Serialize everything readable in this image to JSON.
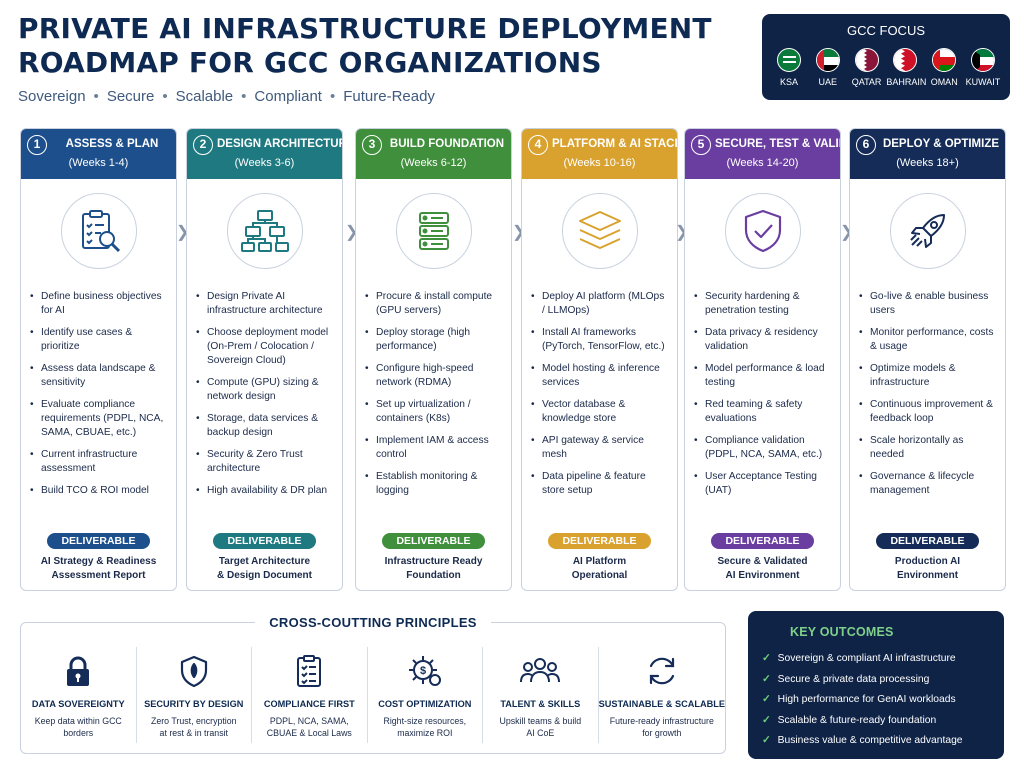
{
  "header": {
    "title": "PRIVATE AI INFRASTRUCTURE DEPLOYMENT ROADMAP FOR GCC ORGANIZATIONS",
    "tagline": [
      "Sovereign",
      "Secure",
      "Scalable",
      "Compliant",
      "Future-Ready"
    ],
    "tagline_separator": "•"
  },
  "gcc": {
    "title": "GCC FOCUS",
    "countries": [
      {
        "label": "KSA",
        "flag_icon": "saudi-flag-icon"
      },
      {
        "label": "UAE",
        "flag_icon": "uae-flag-icon"
      },
      {
        "label": "QATAR",
        "flag_icon": "qatar-flag-icon"
      },
      {
        "label": "BAHRAIN",
        "flag_icon": "bahrain-flag-icon"
      },
      {
        "label": "OMAN",
        "flag_icon": "oman-flag-icon"
      },
      {
        "label": "KUWAIT",
        "flag_icon": "kuwait-flag-icon"
      }
    ]
  },
  "phases": [
    {
      "num": "1",
      "title": "ASSESS & PLAN",
      "weeks": "(Weeks 1-4)",
      "color": "#1d4f8c",
      "icon": "clipboard-search-icon",
      "items": [
        "Define business objectives for AI",
        "Identify use cases & prioritize",
        "Assess data landscape & sensitivity",
        "Evaluate compliance requirements (PDPL, NCA, SAMA, CBUAE, etc.)",
        "Current infrastructure assessment",
        "Build TCO & ROI model"
      ],
      "deliverable_label": "DELIVERABLE",
      "deliverable_lines": [
        "AI Strategy & Readiness",
        "Assessment Report"
      ]
    },
    {
      "num": "2",
      "title": "DESIGN ARCHITECTURE",
      "weeks": "(Weeks 3-6)",
      "color": "#1e7a80",
      "icon": "hierarchy-icon",
      "items": [
        "Design Private AI infrastructure architecture",
        "Choose deployment model (On-Prem / Colocation / Sovereign Cloud)",
        "Compute (GPU) sizing & network design",
        "Storage, data services & backup design",
        "Security & Zero Trust architecture",
        "High availability & DR plan"
      ],
      "deliverable_label": "DELIVERABLE",
      "deliverable_lines": [
        "Target Architecture",
        "& Design Document"
      ]
    },
    {
      "num": "3",
      "title": "BUILD FOUNDATION",
      "weeks": "(Weeks 6-12)",
      "color": "#3f8f3c",
      "icon": "server-rack-icon",
      "items": [
        "Procure & install compute (GPU servers)",
        "Deploy storage (high performance)",
        "Configure high-speed network (RDMA)",
        "Set up virtualization / containers (K8s)",
        "Implement IAM & access control",
        "Establish monitoring & logging"
      ],
      "deliverable_label": "DELIVERABLE",
      "deliverable_lines": [
        "Infrastructure Ready",
        "Foundation"
      ]
    },
    {
      "num": "4",
      "title": "PLATFORM & AI STACK",
      "weeks": "(Weeks 10-16)",
      "color": "#d9a22e",
      "icon": "layers-icon",
      "items": [
        "Deploy AI platform (MLOps / LLMOps)",
        "Install AI frameworks (PyTorch, TensorFlow, etc.)",
        "Model hosting & inference services",
        "Vector database & knowledge store",
        "API gateway & service mesh",
        "Data pipeline & feature store setup"
      ],
      "deliverable_label": "DELIVERABLE",
      "deliverable_lines": [
        "AI Platform",
        "Operational"
      ]
    },
    {
      "num": "5",
      "title": "SECURE, TEST & VALIDATE",
      "weeks": "(Weeks 14-20)",
      "color": "#6a3ea1",
      "icon": "shield-check-icon",
      "items": [
        "Security hardening & penetration testing",
        "Data privacy & residency validation",
        "Model performance & load testing",
        "Red teaming & safety evaluations",
        "Compliance validation (PDPL, NCA, SAMA, etc.)",
        "User Acceptance Testing (UAT)"
      ],
      "deliverable_label": "DELIVERABLE",
      "deliverable_lines": [
        "Secure & Validated",
        "AI Environment"
      ]
    },
    {
      "num": "6",
      "title": "DEPLOY & OPTIMIZE",
      "weeks": "(Weeks 18+)",
      "color": "#142c57",
      "icon": "rocket-icon",
      "items": [
        "Go-live & enable business users",
        "Monitor performance, costs & usage",
        "Optimize models & infrastructure",
        "Continuous improvement & feedback loop",
        "Scale horizontally as needed",
        "Governance & lifecycle management"
      ],
      "deliverable_label": "DELIVERABLE",
      "deliverable_lines": [
        "Production AI",
        "Environment"
      ]
    }
  ],
  "cross": {
    "title": "CROSS-COUTTING PRINCIPLES",
    "principles": [
      {
        "name": "DATA SOVEREIGNTY",
        "desc_lines": [
          "Keep data within GCC",
          "borders"
        ],
        "icon": "lock-icon"
      },
      {
        "name": "SECURITY BY DESIGN",
        "desc_lines": [
          "Zero Trust, encryption",
          "at rest & in transit"
        ],
        "icon": "shield-icon"
      },
      {
        "name": "COMPLIANCE FIRST",
        "desc_lines": [
          "PDPL, NCA, SAMA,",
          "CBUAE & Local Laws"
        ],
        "icon": "checklist-icon"
      },
      {
        "name": "COST OPTIMIZATION",
        "desc_lines": [
          "Right-size resources,",
          "maximize ROI"
        ],
        "icon": "gear-dollar-icon"
      },
      {
        "name": "TALENT & SKILLS",
        "desc_lines": [
          "Upskill teams & build",
          "AI CoE"
        ],
        "icon": "team-icon"
      },
      {
        "name": "SUSTAINABLE & SCALABLE",
        "desc_lines": [
          "Future-ready infrastructure",
          "for growth"
        ],
        "icon": "refresh-icon"
      }
    ]
  },
  "outcomes": {
    "title": "KEY OUTCOMES",
    "items": [
      "Sovereign & compliant AI infrastructure",
      "Secure & private data processing",
      "High performance for GenAI workloads",
      "Scalable & future-ready foundation",
      "Business value & competitive advantage"
    ]
  }
}
